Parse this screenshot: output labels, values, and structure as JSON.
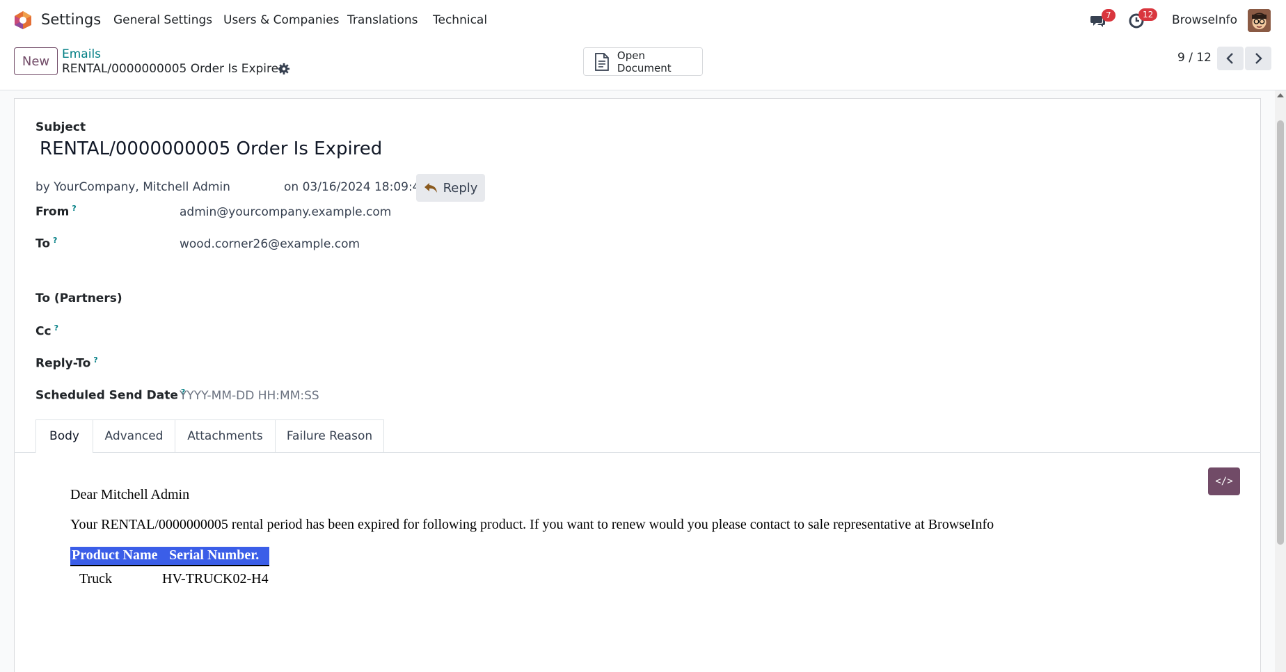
{
  "navbar": {
    "app_name": "Settings",
    "menu": [
      "General Settings",
      "Users & Companies",
      "Translations",
      "Technical"
    ],
    "messages_badge": "7",
    "activities_badge": "12",
    "company": "BrowseInfo"
  },
  "control_panel": {
    "new_label": "New",
    "breadcrumb_parent": "Emails",
    "breadcrumb_current": "RENTAL/0000000005 Order Is Expired",
    "open_document_label": "Open Document",
    "pager": "9 / 12"
  },
  "form": {
    "subject_label": "Subject",
    "subject": "RENTAL/0000000005 Order Is Expired",
    "author": "by YourCompany, Mitchell Admin",
    "date": "on 03/16/2024 18:09:45",
    "reply_label": "Reply",
    "from_label": "From",
    "from": "admin@yourcompany.example.com",
    "to_label": "To",
    "to": "wood.corner26@example.com",
    "to_partners_label": "To (Partners)",
    "cc_label": "Cc",
    "reply_to_label": "Reply-To",
    "scheduled_label": "Scheduled Send Date",
    "scheduled_placeholder": "YYYY-MM-DD HH:MM:SS",
    "help_mark": "?"
  },
  "tabs": [
    "Body",
    "Advanced",
    "Attachments",
    "Failure Reason"
  ],
  "body": {
    "code_view_label": "</>",
    "greeting": "Dear Mitchell Admin",
    "paragraph": "Your RENTAL/0000000005 rental period has been expired for following product. If you want to renew would you please contact to sale representative at BrowseInfo",
    "table": {
      "headers": [
        "Product Name",
        "Serial Number."
      ],
      "rows": [
        [
          "Truck",
          "HV-TRUCK02-H4"
        ]
      ]
    }
  },
  "colors": {
    "brand": "#714b67",
    "link": "#017e84",
    "badge": "#d9363e",
    "table_header": "#3b5ee8"
  }
}
